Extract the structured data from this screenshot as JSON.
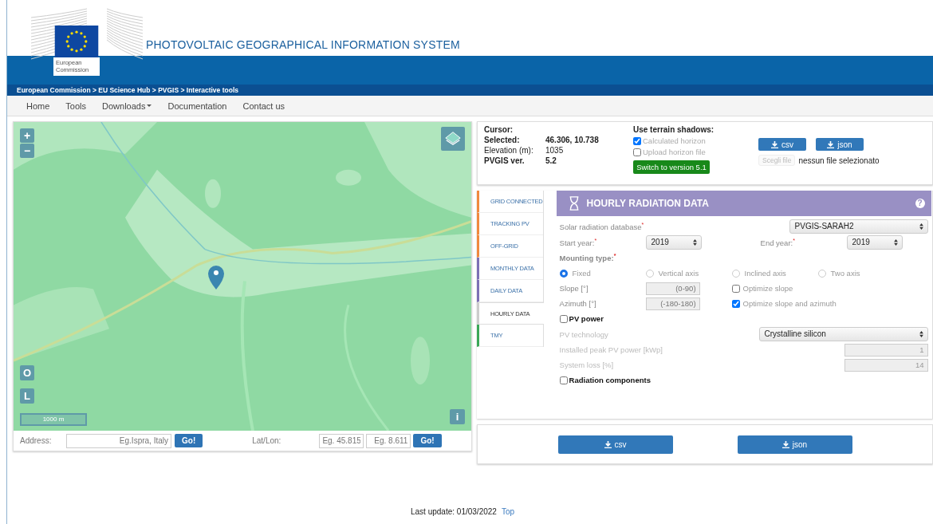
{
  "header": {
    "logo_caption": [
      "European",
      "Commission"
    ],
    "title": "PHOTOVOLTAIC GEOGRAPHICAL INFORMATION SYSTEM"
  },
  "breadcrumb": "European Commission > EU Science Hub > PVGIS > Interactive tools",
  "nav": [
    {
      "label": "Home",
      "dropdown": false
    },
    {
      "label": "Tools",
      "dropdown": false
    },
    {
      "label": "Downloads",
      "dropdown": true
    },
    {
      "label": "Documentation",
      "dropdown": false
    },
    {
      "label": "Contact us",
      "dropdown": false
    }
  ],
  "map": {
    "zoom_in": "+",
    "zoom_out": "−",
    "buttons": [
      "O",
      "L"
    ],
    "info": "i",
    "scale": "1000 m",
    "address": {
      "label": "Address:",
      "placeholder": "Eg.Ispra, Italy",
      "go": "Go!"
    },
    "latlon": {
      "label": "Lat/Lon:",
      "lat_placeholder": "Eg. 45.815",
      "lon_placeholder": "Eg. 8.611",
      "go": "Go!"
    }
  },
  "info": {
    "cursor_label": "Cursor:",
    "rows": [
      {
        "label": "Selected:",
        "value": "46.306, 10.738",
        "bold": true
      },
      {
        "label": "Elevation (m):",
        "value": "1035",
        "bold": false
      },
      {
        "label": "PVGIS ver.",
        "value": "5.2",
        "bold": true
      }
    ],
    "shadows_title": "Use terrain shadows:",
    "options": [
      {
        "label": "Calculated horizon",
        "checked": true
      },
      {
        "label": "Upload horizon file",
        "checked": false
      }
    ],
    "switch": "Switch to version 5.1",
    "downloads": [
      "csv",
      "json"
    ],
    "file_button": "Scegli file",
    "file_status": "nessun file selezionato"
  },
  "tabs": [
    {
      "label": "GRID CONNECTED",
      "color": "#f0883e",
      "selected": false
    },
    {
      "label": "TRACKING PV",
      "color": "#f0883e",
      "selected": false
    },
    {
      "label": "OFF-GRID",
      "color": "#f0883e",
      "selected": false
    },
    {
      "label": "MONTHLY DATA",
      "color": "#7d6fb5",
      "selected": false
    },
    {
      "label": "DAILY DATA",
      "color": "#7d6fb5",
      "selected": false
    },
    {
      "label": "HOURLY DATA",
      "color": "#cccccc",
      "selected": true
    },
    {
      "label": "TMY",
      "color": "#3aa757",
      "selected": false
    }
  ],
  "form": {
    "title": "HOURLY RADIATION DATA",
    "help": "?",
    "database": {
      "label": "Solar radiation database$^{*}$",
      "value": "PVGIS-SARAH2"
    },
    "start": {
      "label": "Start year:$^{*}$",
      "value": "2019"
    },
    "end": {
      "label": "End year:$^{*}$",
      "value": "2019"
    },
    "mounting_label": "Mounting type:$^{*}$",
    "mounting": [
      {
        "label": "Fixed",
        "selected": true
      },
      {
        "label": "Vertical axis",
        "selected": false
      },
      {
        "label": "Inclined axis",
        "selected": false
      },
      {
        "label": "Two axis",
        "selected": false
      }
    ],
    "slope": {
      "label": "Slope [°]",
      "placeholder": "(0-90)"
    },
    "azimuth": {
      "label": "Azimuth [°]",
      "placeholder": "(-180-180)"
    },
    "optimize": [
      {
        "label": "Optimize slope",
        "checked": false
      },
      {
        "label": "Optimize slope and azimuth",
        "checked": true
      }
    ],
    "pv_power": {
      "label": "PV power",
      "checked": false
    },
    "technology": {
      "label": "PV technology",
      "value": "Crystalline silicon"
    },
    "peak": {
      "label": "Installed peak PV power [kWp]",
      "value": "1"
    },
    "loss": {
      "label": "System loss [%]",
      "value": "14"
    },
    "components": {
      "label": "Radiation components",
      "checked": false
    }
  },
  "downloads": [
    "csv",
    "json"
  ],
  "footer": {
    "text": "Last update: 01/03/2022",
    "link": "Top"
  }
}
